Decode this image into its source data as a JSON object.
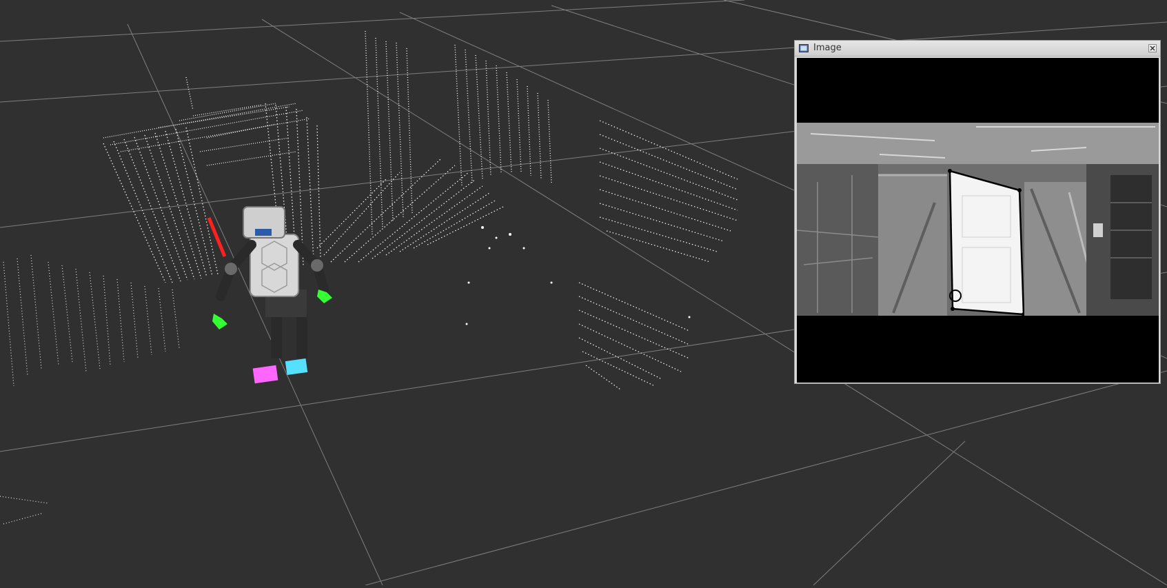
{
  "image_panel": {
    "title": "Image",
    "icon": "image-window-icon",
    "close_icon": "close-icon"
  },
  "scene": {
    "background": "#303030",
    "grid_color": "#9a9a9a",
    "point_cloud_color": "#ffffff",
    "robot_torso_color": "#d8d8d8",
    "left_foot_color": "#ff66ff",
    "right_foot_color": "#55e0ff",
    "hand_color": "#33ff33",
    "marker_color": "#ff2020"
  },
  "camera_view": {
    "overlay_color": "#ffffff",
    "outline_color": "#000000"
  }
}
